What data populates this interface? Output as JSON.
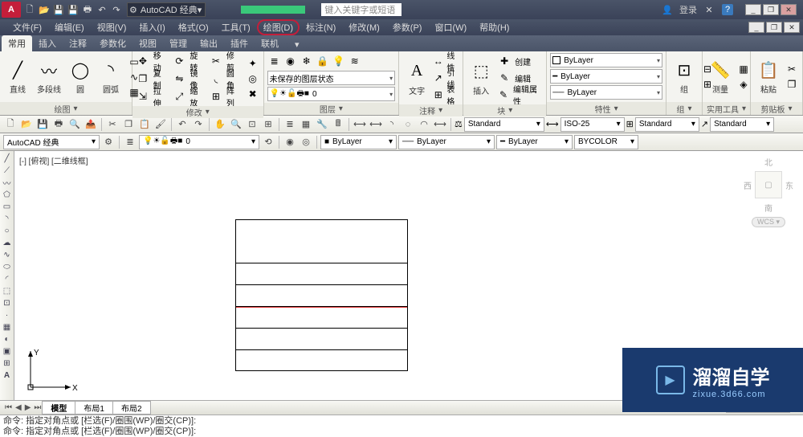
{
  "title": {
    "workspace": "AutoCAD 经典",
    "search_placeholder": "键入关键字或短语",
    "login": "登录",
    "win_min": "_",
    "win_max": "❐",
    "win_close": "✕",
    "app_min": "_",
    "app_max": "❐",
    "app_close": "✕"
  },
  "menu": {
    "items": [
      "文件(F)",
      "编辑(E)",
      "视图(V)",
      "插入(I)",
      "格式(O)",
      "工具(T)",
      "绘图(D)",
      "标注(N)",
      "修改(M)",
      "参数(P)",
      "窗口(W)",
      "帮助(H)"
    ]
  },
  "tabs": {
    "items": [
      "常用",
      "插入",
      "注释",
      "参数化",
      "视图",
      "管理",
      "输出",
      "插件",
      "联机"
    ]
  },
  "ribbon": {
    "draw": {
      "title": "绘图",
      "line": "直线",
      "polyline": "多段线",
      "circle": "圆",
      "arc": "圆弧"
    },
    "modify": {
      "title": "修改",
      "move": "移动",
      "rotate": "旋转",
      "trim": "修剪",
      "copy": "复制",
      "mirror": "镜像",
      "fillet": "圆角",
      "stretch": "拉伸",
      "scale": "缩放",
      "array": "阵列"
    },
    "layer": {
      "title": "图层",
      "state": "未保存的图层状态",
      "current": "0"
    },
    "annot": {
      "title": "注释",
      "text": "文字",
      "linear": "线性",
      "leader": "引线",
      "table": "表格"
    },
    "block": {
      "title": "块",
      "insert": "插入",
      "create": "创建",
      "edit": "编辑",
      "attr": "编辑属性"
    },
    "props": {
      "title": "特性",
      "layer": "ByLayer",
      "linetype": "ByLayer",
      "lineweight": "ByLayer"
    },
    "group": {
      "title": "组",
      "label": "组"
    },
    "util": {
      "title": "实用工具",
      "measure": "测量"
    },
    "clip": {
      "title": "剪贴板",
      "paste": "粘贴"
    }
  },
  "toolbar1": {
    "dim": "Standard",
    "dimstyle": "ISO-25",
    "table": "Standard",
    "mleader": "Standard"
  },
  "toolbar2": {
    "workspace": "AutoCAD 经典",
    "layer": "0",
    "color": "ByLayer",
    "linetype": "ByLayer",
    "lineweight": "ByLayer",
    "plot": "BYCOLOR"
  },
  "viewport": {
    "label": "[-] [俯视] [二维线框]",
    "wcs": "WCS",
    "north": "北",
    "south": "南",
    "east": "东",
    "west": "西"
  },
  "layouts": {
    "nav": "⏮◀▶⏭",
    "model": "模型",
    "l1": "布局1",
    "l2": "布局2"
  },
  "cmd": {
    "line1": "命令: 指定对角点或 [栏选(F)/圈围(WP)/圈交(CP)]:",
    "line2": "命令: 指定对角点或 [栏选(F)/圈围(WP)/圈交(CP)]:"
  },
  "watermark": {
    "brand": "溜溜自学",
    "url": "zixue.3d66.com"
  }
}
